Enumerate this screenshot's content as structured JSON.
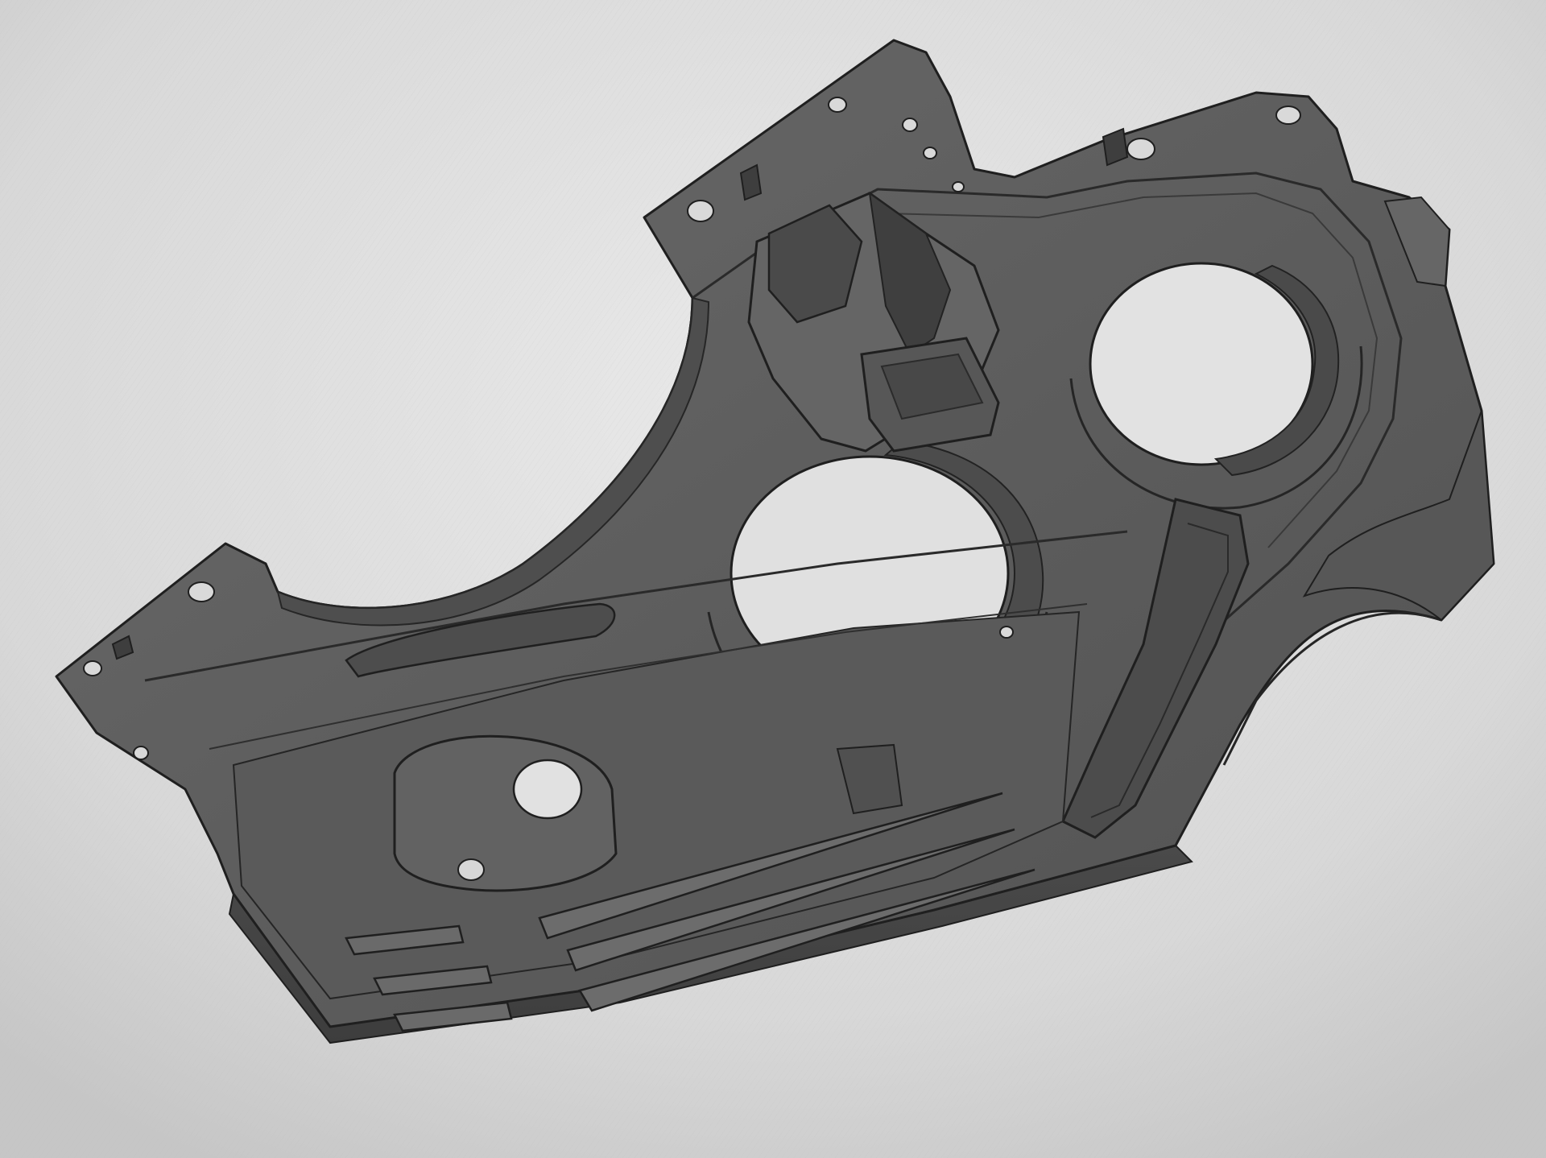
{
  "photo": {
    "subject": "cad-model-housing",
    "colors": {
      "background_light": "#e8e8e8",
      "background_dark": "#c9c9c9",
      "part_base": "#5f5f5f",
      "part_light": "#727272",
      "part_dark": "#4a4a4a",
      "part_edge": "#1f1f1f",
      "hole_fill": "#dedede"
    }
  }
}
